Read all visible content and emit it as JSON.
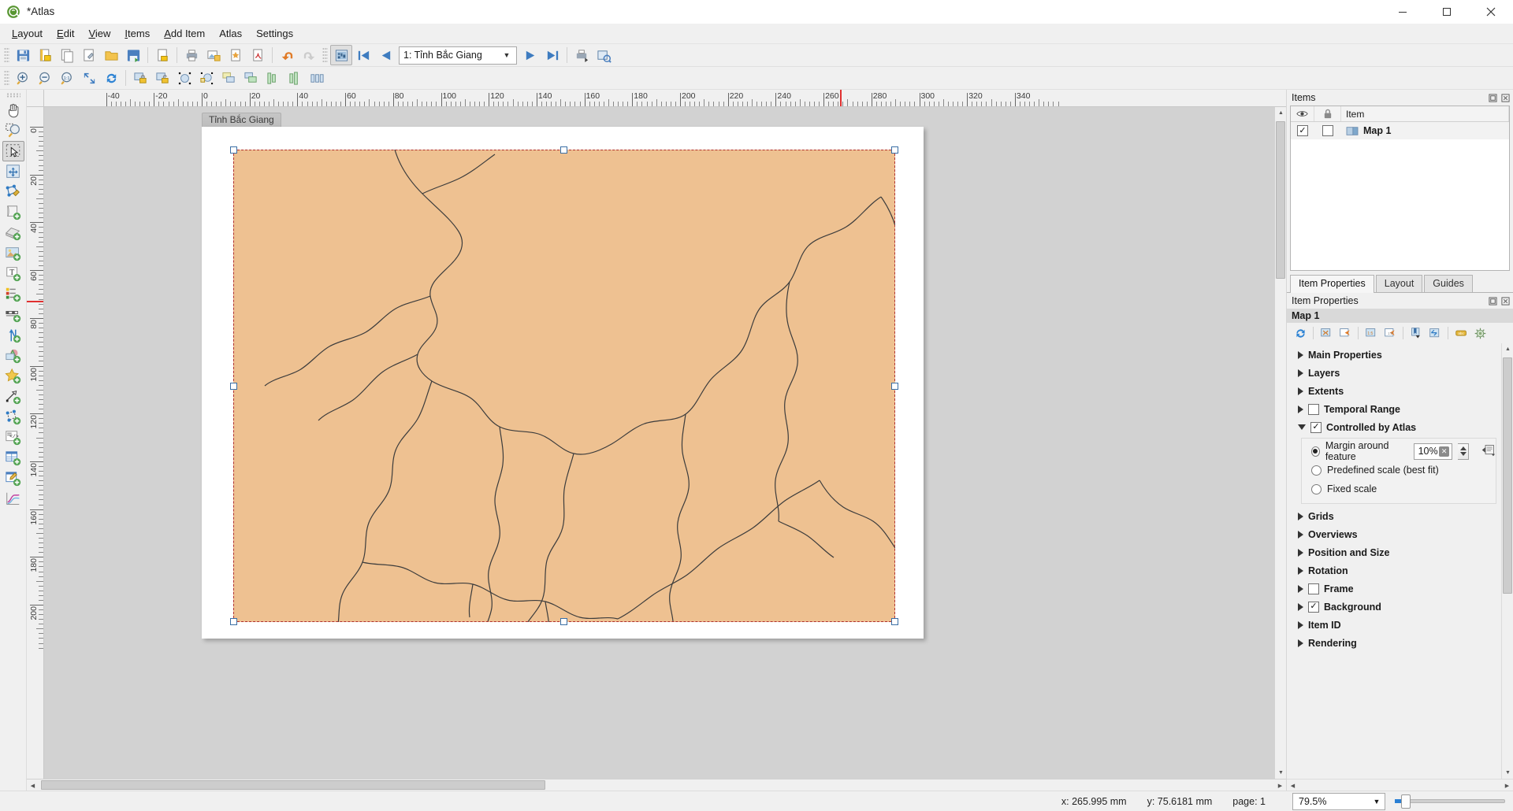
{
  "window": {
    "title": "*Atlas",
    "logo_icon": "qgis-logo-icon",
    "minimize_label": "–",
    "maximize_label": "❐",
    "close_label": "✕"
  },
  "menubar": {
    "items": [
      {
        "label": "Layout",
        "name": "menu-layout"
      },
      {
        "label": "Edit",
        "name": "menu-edit"
      },
      {
        "label": "View",
        "name": "menu-view"
      },
      {
        "label": "Items",
        "name": "menu-items"
      },
      {
        "label": "Add Item",
        "name": "menu-add-item"
      },
      {
        "label": "Atlas",
        "name": "menu-atlas"
      },
      {
        "label": "Settings",
        "name": "menu-settings"
      }
    ]
  },
  "toolbar_main": {
    "buttons": [
      {
        "name": "save-project-button",
        "icon": "save-icon",
        "tooltip": "Save Project"
      },
      {
        "name": "new-layout-button",
        "icon": "new-layout-icon",
        "tooltip": "New Layout"
      },
      {
        "name": "duplicate-layout-button",
        "icon": "duplicate-layout-icon",
        "tooltip": "Duplicate Layout"
      },
      {
        "name": "layout-manager-button",
        "icon": "layout-manager-icon",
        "tooltip": "Layout Manager"
      },
      {
        "name": "open-template-button",
        "icon": "folder-icon",
        "tooltip": "Add Items from Template"
      },
      {
        "name": "save-template-button",
        "icon": "save-template-icon",
        "tooltip": "Save as Template"
      },
      {
        "name": "export-image-button",
        "icon": "export-image-icon",
        "tooltip": "Export as Image"
      },
      {
        "name": "print-button",
        "icon": "printer-icon",
        "tooltip": "Print Layout"
      },
      {
        "name": "export-raster-button",
        "icon": "export-raster-icon",
        "tooltip": "Export as Image"
      },
      {
        "name": "export-svg-button",
        "icon": "export-svg-icon",
        "tooltip": "Export as SVG"
      },
      {
        "name": "export-pdf-button",
        "icon": "export-pdf-icon",
        "tooltip": "Export as PDF"
      },
      {
        "name": "undo-button",
        "icon": "undo-icon",
        "tooltip": "Undo"
      },
      {
        "name": "redo-button",
        "icon": "redo-icon",
        "tooltip": "Redo"
      }
    ]
  },
  "toolbar_atlas": {
    "preview_atlas": {
      "name": "preview-atlas-button",
      "icon": "atlas-preview-icon",
      "checked": true
    },
    "first_feature": {
      "name": "atlas-first-feature-button",
      "icon": "first-feature-icon"
    },
    "previous_feature": {
      "name": "atlas-previous-feature-button",
      "icon": "previous-feature-icon"
    },
    "feature_combo": {
      "name": "atlas-feature-combo",
      "value": "1: Tỉnh Bắc Giang",
      "arrow_icon": "chevron-down-icon"
    },
    "next_feature": {
      "name": "atlas-next-feature-button",
      "icon": "next-feature-icon"
    },
    "last_feature": {
      "name": "atlas-last-feature-button",
      "icon": "last-feature-icon"
    },
    "print_atlas": {
      "name": "print-atlas-button",
      "icon": "print-atlas-icon"
    },
    "export_atlas": {
      "name": "export-atlas-button",
      "icon": "export-atlas-icon"
    },
    "atlas_settings": {
      "name": "atlas-settings-button",
      "icon": "atlas-settings-icon"
    }
  },
  "toolbar_nav": {
    "buttons": [
      {
        "name": "zoom-in-button",
        "icon": "zoom-in-icon"
      },
      {
        "name": "zoom-out-button",
        "icon": "zoom-out-icon"
      },
      {
        "name": "zoom-full-button",
        "icon": "zoom-100-icon"
      },
      {
        "name": "zoom-to-width-button",
        "icon": "zoom-to-width-icon"
      },
      {
        "name": "refresh-view-button",
        "icon": "refresh-icon"
      },
      {
        "name": "lock-selected-items-button",
        "icon": "lock-items-icon"
      },
      {
        "name": "unlock-all-items-button",
        "icon": "unlock-items-icon"
      },
      {
        "name": "group-items-button",
        "icon": "group-items-icon"
      },
      {
        "name": "ungroup-items-button",
        "icon": "ungroup-items-icon"
      },
      {
        "name": "raise-items-button",
        "icon": "raise-items-icon"
      },
      {
        "name": "lower-items-button",
        "icon": "lower-items-icon"
      },
      {
        "name": "align-left-button",
        "icon": "align-left-icon"
      },
      {
        "name": "align-center-button",
        "icon": "align-center-icon"
      },
      {
        "name": "distribute-button",
        "icon": "distribute-icon"
      }
    ]
  },
  "left_toolbox": {
    "tools": [
      {
        "name": "pan-layout-tool",
        "icon": "pan-hand-icon",
        "checked": false
      },
      {
        "name": "zoom-tool",
        "icon": "zoom-magnifier-icon",
        "checked": false
      },
      {
        "name": "select-move-item-tool",
        "icon": "select-arrow-icon",
        "checked": true
      },
      {
        "name": "move-item-content-tool",
        "icon": "move-content-icon",
        "checked": false
      },
      {
        "name": "edit-nodes-tool",
        "icon": "edit-nodes-icon",
        "checked": false
      },
      {
        "name": "add-map-tool",
        "icon": "add-map-icon",
        "checked": false
      },
      {
        "name": "add-3d-map-tool",
        "icon": "add-3d-map-icon",
        "checked": false
      },
      {
        "name": "add-picture-tool",
        "icon": "add-picture-icon",
        "checked": false
      },
      {
        "name": "add-label-tool",
        "icon": "add-label-icon",
        "checked": false
      },
      {
        "name": "add-legend-tool",
        "icon": "add-legend-icon",
        "checked": false
      },
      {
        "name": "add-scalebar-tool",
        "icon": "add-scalebar-icon",
        "checked": false
      },
      {
        "name": "add-north-arrow-tool",
        "icon": "add-north-arrow-icon",
        "checked": false
      },
      {
        "name": "add-shape-tool",
        "icon": "add-shape-icon",
        "checked": false
      },
      {
        "name": "add-marker-tool",
        "icon": "add-marker-star-icon",
        "checked": false
      },
      {
        "name": "add-arrow-tool",
        "icon": "add-arrow-icon",
        "checked": false
      },
      {
        "name": "add-node-item-tool",
        "icon": "add-node-item-icon",
        "checked": false
      },
      {
        "name": "add-html-tool",
        "icon": "add-html-icon",
        "checked": false
      },
      {
        "name": "add-table-tool",
        "icon": "add-table-icon",
        "checked": false
      },
      {
        "name": "add-attribute-table-tool",
        "icon": "add-attribute-table-icon",
        "checked": false
      },
      {
        "name": "add-elevation-profile-tool",
        "icon": "add-elevation-profile-icon",
        "checked": false
      }
    ]
  },
  "canvas": {
    "page_label": "Tỉnh Bắc Giang",
    "map_background_color": "#eec191",
    "map_outline_color": "#3c3c3c",
    "selection_color": "#b03030",
    "handle_color": "#3a6ea5",
    "h_ruler_labels": [
      "-40",
      "-20",
      "0",
      "20",
      "40",
      "60",
      "80",
      "100",
      "120",
      "140",
      "160",
      "180",
      "200",
      "220",
      "240",
      "260",
      "280",
      "300",
      "320",
      "340"
    ],
    "v_ruler_labels": [
      "0",
      "20",
      "40",
      "60",
      "80",
      "100",
      "120",
      "140",
      "160",
      "180",
      "200"
    ]
  },
  "items_panel": {
    "title": "Items",
    "float_icon": "undock-icon",
    "close_icon": "close-icon",
    "columns": [
      {
        "name": "visibility-column",
        "icon": "eye-icon",
        "label": ""
      },
      {
        "name": "lock-column",
        "icon": "lock-icon",
        "label": ""
      },
      {
        "name": "item-column",
        "icon": "",
        "label": "Item"
      }
    ],
    "rows": [
      {
        "visible": true,
        "locked": false,
        "icon": "map-item-icon",
        "label": "Map 1"
      }
    ]
  },
  "tabs": [
    {
      "name": "tab-item-properties",
      "label": "Item Properties",
      "active": true
    },
    {
      "name": "tab-layout",
      "label": "Layout",
      "active": false
    },
    {
      "name": "tab-guides",
      "label": "Guides",
      "active": false
    }
  ],
  "item_properties": {
    "title": "Item Properties",
    "float_icon": "undock-icon",
    "close_icon": "close-icon",
    "item_name": "Map 1",
    "toolbar": [
      {
        "name": "update-map-preview-button",
        "icon": "refresh-icon"
      },
      {
        "name": "set-map-extent-to-layout-button",
        "icon": "set-extent-icon"
      },
      {
        "name": "view-extent-in-map-button",
        "icon": "view-extent-icon"
      },
      {
        "name": "set-map-scale-button",
        "icon": "set-scale-icon"
      },
      {
        "name": "view-scale-in-map-button",
        "icon": "view-scale-icon"
      },
      {
        "name": "bookmarks-button",
        "icon": "bookmark-icon"
      },
      {
        "name": "interactive-edit-button",
        "icon": "interactive-edit-icon"
      },
      {
        "name": "labeling-button",
        "icon": "abc-label-icon"
      },
      {
        "name": "rendering-settings-button",
        "icon": "rendering-icon"
      }
    ],
    "sections": [
      {
        "name": "section-main-properties",
        "label": "Main Properties",
        "expanded": false,
        "checkbox": null
      },
      {
        "name": "section-layers",
        "label": "Layers",
        "expanded": false,
        "checkbox": null
      },
      {
        "name": "section-extents",
        "label": "Extents",
        "expanded": false,
        "checkbox": null
      },
      {
        "name": "section-temporal-range",
        "label": "Temporal Range",
        "expanded": false,
        "checkbox": false
      },
      {
        "name": "section-controlled-by-atlas",
        "label": "Controlled by Atlas",
        "expanded": true,
        "checkbox": true
      },
      {
        "name": "section-grids",
        "label": "Grids",
        "expanded": false,
        "checkbox": null
      },
      {
        "name": "section-overviews",
        "label": "Overviews",
        "expanded": false,
        "checkbox": null
      },
      {
        "name": "section-position-and-size",
        "label": "Position and Size",
        "expanded": false,
        "checkbox": null
      },
      {
        "name": "section-rotation",
        "label": "Rotation",
        "expanded": false,
        "checkbox": null
      },
      {
        "name": "section-frame",
        "label": "Frame",
        "expanded": false,
        "checkbox": false
      },
      {
        "name": "section-background",
        "label": "Background",
        "expanded": false,
        "checkbox": true
      },
      {
        "name": "section-item-id",
        "label": "Item ID",
        "expanded": false,
        "checkbox": null
      },
      {
        "name": "section-rendering",
        "label": "Rendering",
        "expanded": false,
        "checkbox": null
      }
    ],
    "atlas_options": {
      "margin_radio_label": "Margin around feature",
      "margin_selected": true,
      "margin_value": "10%",
      "margin_clear_icon": "clear-value-icon",
      "margin_data_defined_icon": "data-defined-override-icon",
      "predefined_radio_label": "Predefined scale (best fit)",
      "predefined_selected": false,
      "fixed_radio_label": "Fixed scale",
      "fixed_selected": false
    }
  },
  "statusbar": {
    "x_coordinate": "x: 265.995 mm",
    "y_coordinate": "y: 75.6181 mm",
    "page": "page: 1",
    "zoom_level": "79.5%",
    "zoom_arrow_icon": "chevron-down-icon"
  }
}
